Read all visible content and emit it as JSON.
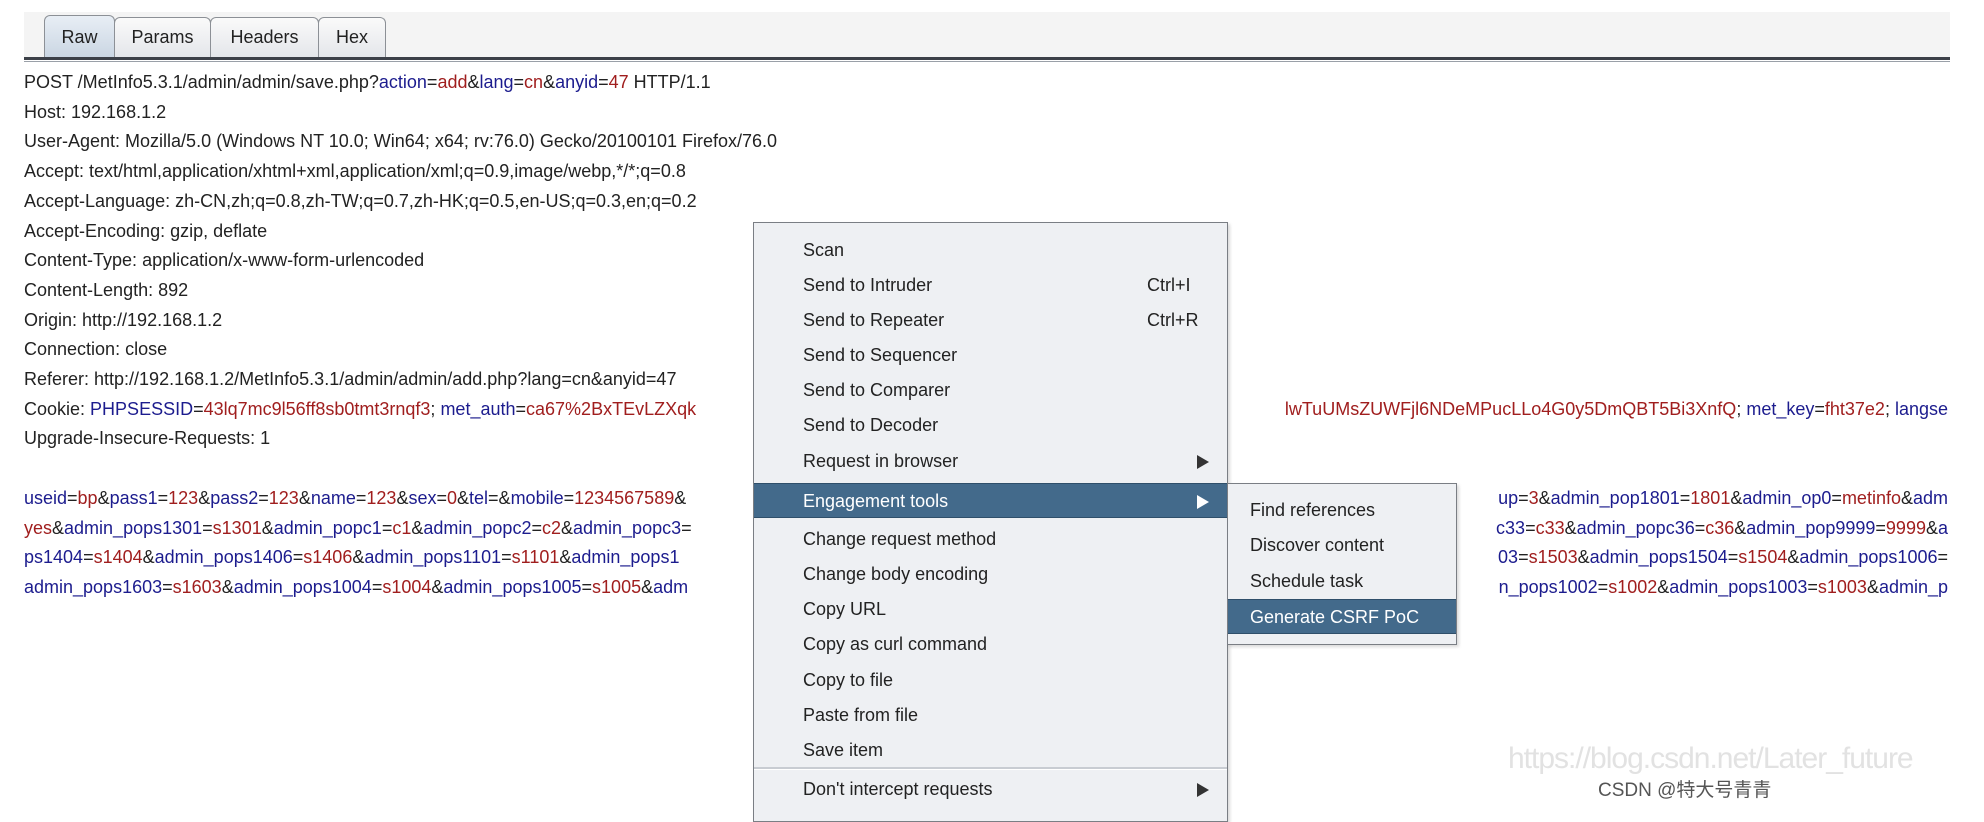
{
  "tabs": [
    {
      "label": "Raw",
      "selected": true
    },
    {
      "label": "Params",
      "selected": false
    },
    {
      "label": "Headers",
      "selected": false
    },
    {
      "label": "Hex",
      "selected": false
    }
  ],
  "request_lines": [
    [
      {
        "kind": "plain",
        "text": "POST /MetInfo5.3.1/admin/admin/save.php?"
      },
      {
        "kind": "query",
        "text": "action=add&lang=cn&anyid=47"
      },
      {
        "kind": "plain",
        "text": " HTTP/1.1"
      }
    ],
    [
      {
        "kind": "plain",
        "text": "Host: 192.168.1.2"
      }
    ],
    [
      {
        "kind": "plain",
        "text": "User-Agent: Mozilla/5.0 (Windows NT 10.0; Win64; x64; rv:76.0) Gecko/20100101 Firefox/76.0"
      }
    ],
    [
      {
        "kind": "plain",
        "text": "Accept: text/html,application/xhtml+xml,application/xml;q=0.9,image/webp,*/*;q=0.8"
      }
    ],
    [
      {
        "kind": "plain",
        "text": "Accept-Language: zh-CN,zh;q=0.8,zh-TW;q=0.7,zh-HK;q=0.5,en-US;q=0.3,en;q=0.2"
      }
    ],
    [
      {
        "kind": "plain",
        "text": "Accept-Encoding: gzip, deflate"
      }
    ],
    [
      {
        "kind": "plain",
        "text": "Content-Type: application/x-www-form-urlencoded"
      }
    ],
    [
      {
        "kind": "plain",
        "text": "Content-Length: 892"
      }
    ],
    [
      {
        "kind": "plain",
        "text": "Origin: http://192.168.1.2"
      }
    ],
    [
      {
        "kind": "plain",
        "text": "Connection: close"
      }
    ],
    [
      {
        "kind": "plain",
        "text": "Referer: http://192.168.1.2/MetInfo5.3.1/admin/admin/add.php?lang=cn&anyid=47"
      }
    ],
    [
      {
        "kind": "plain",
        "text": "Cookie: "
      },
      {
        "kind": "query",
        "text": "PHPSESSID=43lq7mc9l56ff8sb0tmt3rnqf3; met_auth=ca67%2BxTEvLZXqk"
      }
    ],
    [
      {
        "kind": "plain",
        "text": "Upgrade-Insecure-Requests: 1"
      }
    ],
    [],
    [
      {
        "kind": "query",
        "text": "useid=bp&pass1=123&pass2=123&name=123&sex=0&tel=&mobile=1234567589&"
      }
    ],
    [
      {
        "kind": "query",
        "start": "value",
        "text": "yes&admin_pops1301=s1301&admin_popc1=c1&admin_popc2=c2&admin_popc3="
      }
    ],
    [
      {
        "kind": "query",
        "text": "ps1404=s1404&admin_pops1406=s1406&admin_pops1101=s1101&admin_pops1"
      }
    ],
    [
      {
        "kind": "query",
        "text": "admin_pops1603=s1603&admin_pops1004=s1004&admin_pops1005=s1005&adm"
      }
    ]
  ],
  "request_lines_right": [
    {
      "line": 11,
      "start": "value",
      "text": "lwTuUMsZUWFjl6NDeMPucLLo4G0y5DmQBT5Bi3XnfQ; met_key=fht37e2; langse"
    },
    {
      "line": 14,
      "start": "key",
      "text": "up=3&admin_pop1801=1801&admin_op0=metinfo&adm"
    },
    {
      "line": 15,
      "start": "key",
      "text": "c33=c33&admin_popc36=c36&admin_pop9999=9999&a"
    },
    {
      "line": 16,
      "start": "key",
      "text": "03=s1503&admin_pops1504=s1504&admin_pops1006="
    },
    {
      "line": 17,
      "start": "key",
      "text": "n_pops1002=s1002&admin_pops1003=s1003&admin_p"
    }
  ],
  "context_menu": {
    "items": [
      {
        "label": "Scan"
      },
      {
        "label": "Send to Intruder",
        "shortcut": "Ctrl+I"
      },
      {
        "label": "Send to Repeater",
        "shortcut": "Ctrl+R"
      },
      {
        "label": "Send to Sequencer"
      },
      {
        "label": "Send to Comparer"
      },
      {
        "label": "Send to Decoder"
      },
      {
        "label": "Request in browser",
        "submenu": true
      },
      {
        "label": "Engagement tools",
        "submenu": true,
        "highlighted": true
      },
      {
        "label": "Change request method"
      },
      {
        "label": "Change body encoding"
      },
      {
        "label": "Copy URL"
      },
      {
        "label": "Copy as curl command"
      },
      {
        "label": "Copy to file"
      },
      {
        "label": "Paste from file"
      },
      {
        "label": "Save item"
      },
      {
        "label": "Don't intercept requests",
        "submenu": true
      }
    ]
  },
  "submenu": {
    "items": [
      {
        "label": "Find references"
      },
      {
        "label": "Discover content"
      },
      {
        "label": "Schedule task"
      },
      {
        "label": "Generate CSRF PoC",
        "highlighted": true
      }
    ]
  },
  "watermark": {
    "url": "https://blog.csdn.net/Later_future",
    "credit": "CSDN @特大号青青"
  },
  "colors": {
    "key": "#1c1c8e",
    "value": "#a01e1e",
    "highlight": "#436a8b",
    "menu_bg": "#eef0f3"
  }
}
